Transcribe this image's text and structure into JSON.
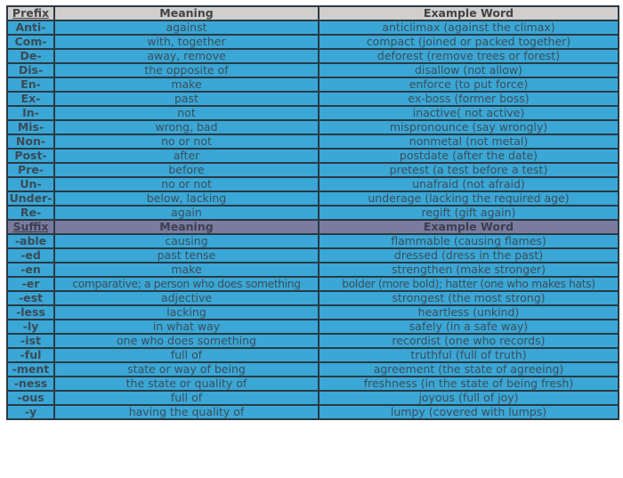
{
  "prefix_section": {
    "headers": {
      "affix": "Prefix",
      "meaning": "Meaning",
      "example": "Example Word"
    },
    "rows": [
      {
        "affix": "Anti-",
        "meaning": "against",
        "example": "anticlimax (against the climax)"
      },
      {
        "affix": "Com-",
        "meaning": "with, together",
        "example": "compact (joined or packed together)"
      },
      {
        "affix": "De-",
        "meaning": "away, remove",
        "example": "deforest (remove trees or forest)"
      },
      {
        "affix": "Dis-",
        "meaning": "the opposite of",
        "example": "disallow (not allow)"
      },
      {
        "affix": "En-",
        "meaning": "make",
        "example": "enforce (to put force)"
      },
      {
        "affix": "Ex-",
        "meaning": "past",
        "example": "ex-boss (former boss)"
      },
      {
        "affix": "In-",
        "meaning": "not",
        "example": "inactive( not active)"
      },
      {
        "affix": "Mis-",
        "meaning": "wrong, bad",
        "example": "mispronounce (say wrongly)"
      },
      {
        "affix": "Non-",
        "meaning": "no or not",
        "example": "nonmetal (not metal)"
      },
      {
        "affix": "Post-",
        "meaning": "after",
        "example": "postdate (after the date)"
      },
      {
        "affix": "Pre-",
        "meaning": "before",
        "example": "pretest (a test before a test)"
      },
      {
        "affix": "Un-",
        "meaning": "no or not",
        "example": "unafraid (not afraid)"
      },
      {
        "affix": "Under-",
        "meaning": "below, lacking",
        "example": "underage (lacking the required age)"
      },
      {
        "affix": "Re-",
        "meaning": "again",
        "example": "regift (gift again)"
      }
    ]
  },
  "suffix_section": {
    "headers": {
      "affix": "Suffix",
      "meaning": "Meaning",
      "example": "Example Word"
    },
    "rows": [
      {
        "affix": "-able",
        "meaning": "causing",
        "example": "flammable (causing flames)"
      },
      {
        "affix": "-ed",
        "meaning": "past tense",
        "example": "dressed (dress in the past)"
      },
      {
        "affix": "-en",
        "meaning": "make",
        "example": "strengthen (make stronger)"
      },
      {
        "affix": "-er",
        "meaning": "comparative; a person who does something",
        "example": "bolder (more bold); hatter (one who makes hats)"
      },
      {
        "affix": "-est",
        "meaning": "adjective",
        "example": "strongest (the most strong)"
      },
      {
        "affix": "-less",
        "meaning": "lacking",
        "example": "heartless (unkind)"
      },
      {
        "affix": "-ly",
        "meaning": "in what way",
        "example": "safely (in a safe way)"
      },
      {
        "affix": "-ist",
        "meaning": "one who does something",
        "example": "recordist (one who records)"
      },
      {
        "affix": "-ful",
        "meaning": "full of",
        "example": "truthful (full of truth)"
      },
      {
        "affix": "-ment",
        "meaning": "state or way of being",
        "example": "agreement (the state of agreeing)"
      },
      {
        "affix": "-ness",
        "meaning": "the state or quality of",
        "example": "freshness (in the state of being fresh)"
      },
      {
        "affix": "-ous",
        "meaning": "full of",
        "example": "joyous (full of joy)"
      },
      {
        "affix": "-y",
        "meaning": "having the quality of",
        "example": "lumpy (covered with lumps)"
      }
    ]
  },
  "colors": {
    "row_background": "#3aa7d6",
    "prefix_header_background": "#d0cfcd",
    "suffix_header_background": "#797c9e",
    "border": "#2b3a44",
    "text": "#3c4e5a"
  }
}
